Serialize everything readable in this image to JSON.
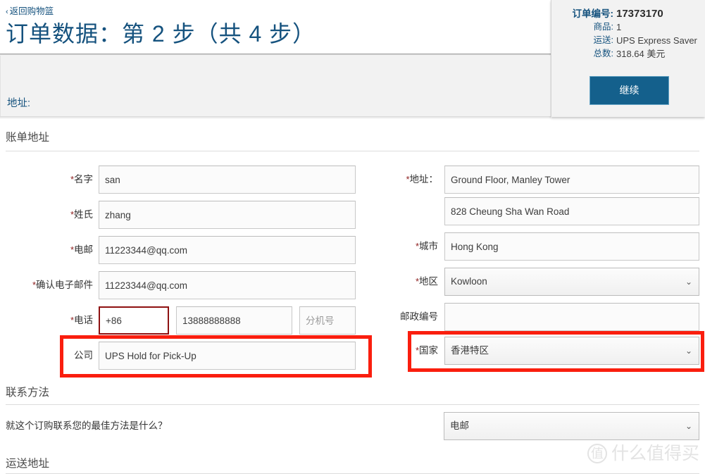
{
  "header": {
    "back_link": {
      "chevron": "‹",
      "label": "返回购物篮"
    },
    "title": "订单数据：第 2 步（共 4 步）"
  },
  "summary": {
    "order_no_label": "订单编号:",
    "order_no_value": "17373170",
    "items_label": "商品:",
    "items_value": "1",
    "shipping_label": "运送:",
    "shipping_value": "UPS Express Saver",
    "total_label": "总数:",
    "total_value": "318.64 美元",
    "continue_label": "继续",
    "accent_color": "#14608c"
  },
  "address_band": {
    "label": "地址:"
  },
  "billing": {
    "heading": "账单地址",
    "first_name": {
      "label": "名字",
      "required": true,
      "value": "san"
    },
    "last_name": {
      "label": "姓氏",
      "required": true,
      "value": "zhang"
    },
    "email": {
      "label": "电邮",
      "required": true,
      "value": "11223344@qq.com"
    },
    "email_confirm": {
      "label": "确认电子邮件",
      "required": true,
      "value": "11223344@qq.com"
    },
    "phone": {
      "label": "电话",
      "required": true,
      "country_code": "+86",
      "number": "13888888888",
      "ext_placeholder": "分机号",
      "ext_value": ""
    },
    "company": {
      "label": "公司",
      "required": false,
      "value": "UPS Hold for Pick-Up"
    },
    "address1": {
      "label": "地址：",
      "required": true,
      "value": "Ground Floor, Manley Tower"
    },
    "address2": {
      "label": "",
      "required": false,
      "value": "828 Cheung Sha Wan Road"
    },
    "city": {
      "label": "城市",
      "required": true,
      "value": "Hong Kong"
    },
    "region": {
      "label": "地区",
      "required": true,
      "value": "Kowloon"
    },
    "postal": {
      "label": "邮政编号",
      "required": false,
      "value": ""
    },
    "country": {
      "label": "国家",
      "required": true,
      "value": "香港特区"
    }
  },
  "contact": {
    "heading": "联系方法",
    "question": "就这个订购联系您的最佳方法是什么？",
    "method_value": "电邮"
  },
  "shipping_section": {
    "heading": "运送地址"
  },
  "icons": {
    "chevron_down": "⌄",
    "chevron_left": "‹"
  },
  "watermark": {
    "badge": "值",
    "text": "什么值得买"
  },
  "annotations": {
    "color": "#fa1e0e"
  }
}
